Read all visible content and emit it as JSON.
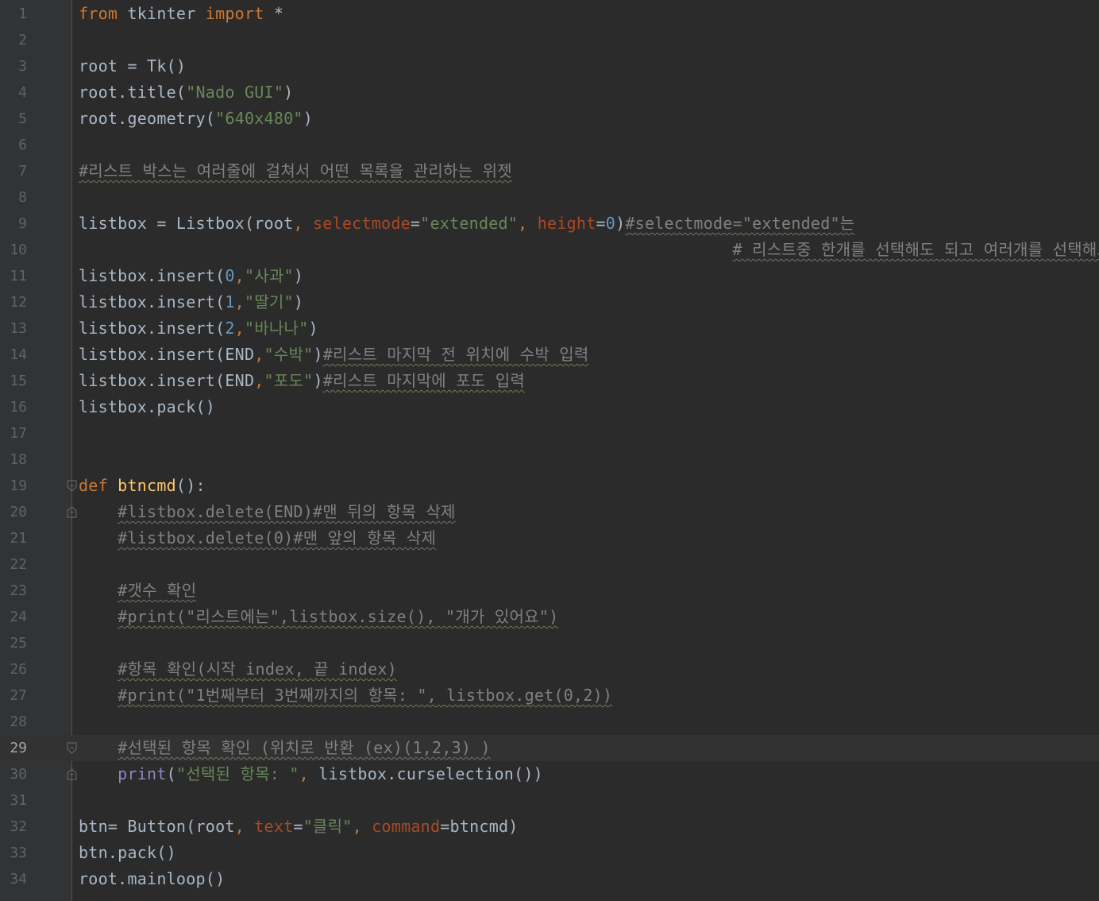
{
  "editor": {
    "language": "python",
    "current_line": "29",
    "colors": {
      "background": "#2b2b2b",
      "gutter": "#313335",
      "keyword": "#cc7832",
      "string": "#6a8759",
      "number": "#6897bb",
      "comment": "#808080",
      "parameter": "#aa4926",
      "function_name": "#ffc66d",
      "builtin": "#8888c6",
      "default_text": "#a9b7c6"
    },
    "lines": [
      {
        "n": "1",
        "t": [
          {
            "k": "kw",
            "v": "from"
          },
          {
            "v": " tkinter "
          },
          {
            "k": "kw",
            "v": "import"
          },
          {
            "v": " *"
          }
        ]
      },
      {
        "n": "2",
        "t": []
      },
      {
        "n": "3",
        "t": [
          {
            "v": "root = Tk()"
          }
        ]
      },
      {
        "n": "4",
        "t": [
          {
            "v": "root.title("
          },
          {
            "k": "str",
            "v": "\"Nado GUI\""
          },
          {
            "v": ")"
          }
        ]
      },
      {
        "n": "5",
        "t": [
          {
            "v": "root.geometry("
          },
          {
            "k": "str",
            "v": "\"640x480\""
          },
          {
            "v": ")"
          }
        ]
      },
      {
        "n": "6",
        "t": []
      },
      {
        "n": "7",
        "t": [
          {
            "k": "cmt",
            "v": "#리스트 박스는 여러줄에 걸쳐서 어떤 목록을 관리하는 위젯"
          }
        ]
      },
      {
        "n": "8",
        "t": []
      },
      {
        "n": "9",
        "t": [
          {
            "v": "listbox = Listbox(root"
          },
          {
            "k": "kw",
            "v": ", "
          },
          {
            "k": "param",
            "v": "selectmode"
          },
          {
            "v": "="
          },
          {
            "k": "str",
            "v": "\"extended\""
          },
          {
            "k": "kw",
            "v": ", "
          },
          {
            "k": "param",
            "v": "height"
          },
          {
            "v": "="
          },
          {
            "k": "num",
            "v": "0"
          },
          {
            "v": ")"
          },
          {
            "k": "cmt",
            "v": "#selectmode=\"extended\"는"
          }
        ]
      },
      {
        "n": "10",
        "t": [
          {
            "v": "                                                                   "
          },
          {
            "k": "cmt",
            "v": "# 리스트중 한개를 선택해도 되고 여러개를 선택해도된다"
          }
        ]
      },
      {
        "n": "11",
        "t": [
          {
            "v": "listbox.insert("
          },
          {
            "k": "num",
            "v": "0"
          },
          {
            "k": "kw",
            "v": ","
          },
          {
            "k": "str",
            "v": "\"사과\""
          },
          {
            "v": ")"
          }
        ]
      },
      {
        "n": "12",
        "t": [
          {
            "v": "listbox.insert("
          },
          {
            "k": "num",
            "v": "1"
          },
          {
            "k": "kw",
            "v": ","
          },
          {
            "k": "str",
            "v": "\"딸기\""
          },
          {
            "v": ")"
          }
        ]
      },
      {
        "n": "13",
        "t": [
          {
            "v": "listbox.insert("
          },
          {
            "k": "num",
            "v": "2"
          },
          {
            "k": "kw",
            "v": ","
          },
          {
            "k": "str",
            "v": "\"바나나\""
          },
          {
            "v": ")"
          }
        ]
      },
      {
        "n": "14",
        "t": [
          {
            "v": "listbox.insert(END"
          },
          {
            "k": "kw",
            "v": ","
          },
          {
            "k": "str",
            "v": "\"수박\""
          },
          {
            "v": ")"
          },
          {
            "k": "cmt",
            "v": "#리스트 마지막 전 위치에 수박 입력"
          }
        ]
      },
      {
        "n": "15",
        "t": [
          {
            "v": "listbox.insert(END"
          },
          {
            "k": "kw",
            "v": ","
          },
          {
            "k": "str",
            "v": "\"포도\""
          },
          {
            "v": ")"
          },
          {
            "k": "cmt",
            "v": "#리스트 마지막에 포도 입력"
          }
        ]
      },
      {
        "n": "16",
        "t": [
          {
            "v": "listbox.pack()"
          }
        ]
      },
      {
        "n": "17",
        "t": []
      },
      {
        "n": "18",
        "t": []
      },
      {
        "n": "19",
        "t": [
          {
            "k": "kw",
            "v": "def "
          },
          {
            "k": "fn",
            "v": "btncmd"
          },
          {
            "v": "():"
          }
        ]
      },
      {
        "n": "20",
        "t": [
          {
            "v": "    "
          },
          {
            "k": "cmt",
            "v": "#listbox.delete(END)#맨 뒤의 항목 삭제"
          }
        ]
      },
      {
        "n": "21",
        "t": [
          {
            "v": "    "
          },
          {
            "k": "cmt",
            "v": "#listbox.delete(0)#맨 앞의 항목 삭제"
          }
        ]
      },
      {
        "n": "22",
        "t": []
      },
      {
        "n": "23",
        "t": [
          {
            "v": "    "
          },
          {
            "k": "cmt",
            "v": "#갯수 확인"
          }
        ]
      },
      {
        "n": "24",
        "t": [
          {
            "v": "    "
          },
          {
            "k": "cmt",
            "v": "#print(\"리스트에는\",listbox.size(), \"개가 있어요\")"
          }
        ]
      },
      {
        "n": "25",
        "t": []
      },
      {
        "n": "26",
        "t": [
          {
            "v": "    "
          },
          {
            "k": "cmt",
            "v": "#항목 확인(시작 index, 끝 index)"
          }
        ]
      },
      {
        "n": "27",
        "t": [
          {
            "v": "    "
          },
          {
            "k": "cmt",
            "v": "#print(\"1번째부터 3번째까지의 항목: \", listbox.get(0,2))"
          }
        ]
      },
      {
        "n": "28",
        "t": []
      },
      {
        "n": "29",
        "t": [
          {
            "v": "    "
          },
          {
            "k": "cmt",
            "v": "#선택된 항목 확인 (위치로 반환 (ex)(1,2,3) )"
          }
        ]
      },
      {
        "n": "30",
        "t": [
          {
            "v": "    "
          },
          {
            "k": "bi",
            "v": "print"
          },
          {
            "v": "("
          },
          {
            "k": "str",
            "v": "\"선택된 항목: \""
          },
          {
            "k": "kw",
            "v": ", "
          },
          {
            "v": "listbox.curselection())"
          }
        ]
      },
      {
        "n": "31",
        "t": []
      },
      {
        "n": "32",
        "t": [
          {
            "v": "btn= Button(root"
          },
          {
            "k": "kw",
            "v": ", "
          },
          {
            "k": "param",
            "v": "text"
          },
          {
            "v": "="
          },
          {
            "k": "str",
            "v": "\"클릭\""
          },
          {
            "k": "kw",
            "v": ", "
          },
          {
            "k": "param",
            "v": "command"
          },
          {
            "v": "=btncmd)"
          }
        ]
      },
      {
        "n": "33",
        "t": [
          {
            "v": "btn.pack()"
          }
        ]
      },
      {
        "n": "34",
        "t": [
          {
            "v": "root.mainloop()"
          }
        ]
      }
    ]
  }
}
